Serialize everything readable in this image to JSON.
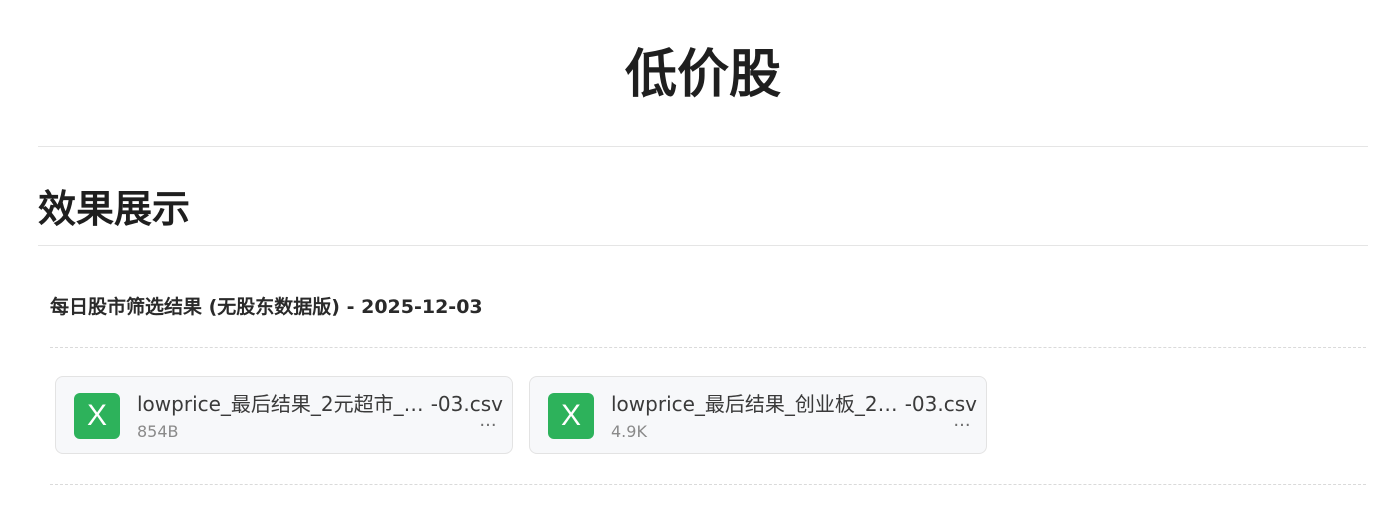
{
  "page": {
    "title": "低价股"
  },
  "section": {
    "heading": "效果展示"
  },
  "result": {
    "subtitle": "每日股市筛选结果 (无股东数据版) - 2025-12-03"
  },
  "attachments": [
    {
      "icon": "excel-icon",
      "icon_glyph": "X",
      "name_start": "lowprice_最后结果_2元超市_2...",
      "name_end": "-03.csv",
      "size": "854B",
      "more_label": "···"
    },
    {
      "icon": "excel-icon",
      "icon_glyph": "X",
      "name_start": "lowprice_最后结果_创业板_20...",
      "name_end": "-03.csv",
      "size": "4.9K",
      "more_label": "···"
    }
  ],
  "colors": {
    "excel_icon_bg": "#2db25b",
    "card_bg": "#f7f8fa",
    "divider": "#e5e5e5"
  }
}
